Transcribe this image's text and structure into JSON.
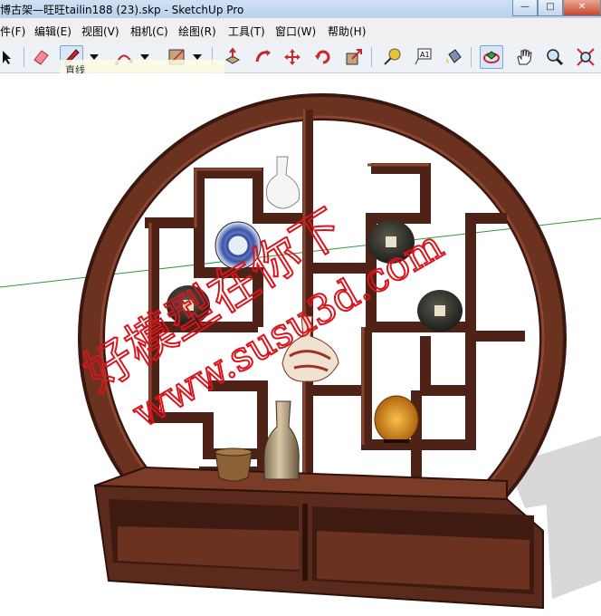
{
  "window": {
    "title": "博古架—旺旺tailin188 (23).skp - SketchUp Pro",
    "minimize": "—",
    "maximize": "□",
    "close": "✕"
  },
  "menu": {
    "items": [
      "件(F)",
      "编辑(E)",
      "视图(V)",
      "相机(C)",
      "绘图(R)",
      "工具(T)",
      "窗口(W)",
      "帮助(H)"
    ]
  },
  "toolbar": {
    "tooltip": "直线",
    "tools": [
      "select-icon",
      "eraser-icon",
      "pencil-icon",
      "dropdown-icon",
      "arc-icon",
      "dropdown-icon",
      "rectangle-icon",
      "dropdown-icon",
      "push-pull-icon",
      "follow-me-icon",
      "move-icon",
      "rotate-icon",
      "scale-icon",
      "tape-measure-icon",
      "text-icon",
      "paint-bucket-icon",
      "orbit-icon",
      "pan-icon",
      "zoom-icon",
      "zoom-extents-icon"
    ],
    "selected": "orbit-icon"
  },
  "watermark": {
    "line1": "好模型在你下",
    "line2": "www.susu3d.com"
  },
  "colors": {
    "wood": "#5a2a1c",
    "wood_light": "#7a3c27",
    "wood_dark": "#3a1810",
    "watermark": "#d9141c",
    "ground_line": "#2e9a3c"
  }
}
